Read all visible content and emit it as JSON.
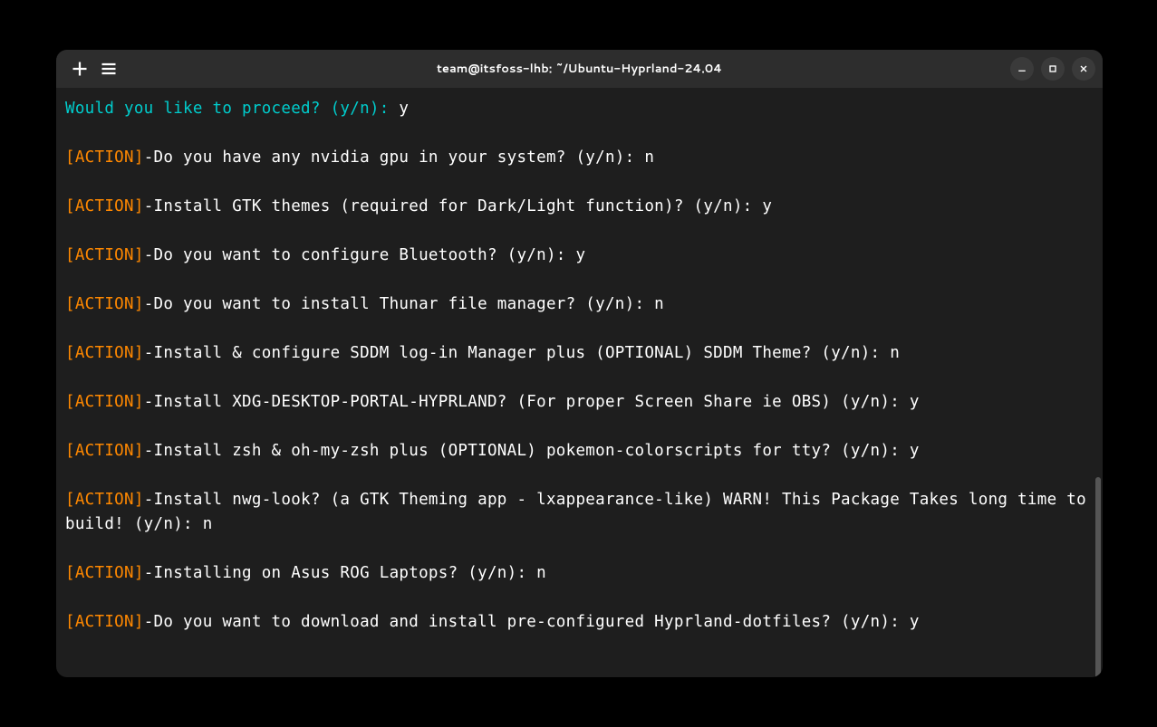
{
  "window": {
    "title": "team@itsfoss-lhb: ~/Ubuntu-Hyprland-24.04"
  },
  "prompt": {
    "question": "Would you like to proceed? (y/n): ",
    "answer": "y"
  },
  "actions": [
    {
      "label": "[ACTION]",
      "text": "-Do you have any nvidia gpu in your system? (y/n): n"
    },
    {
      "label": "[ACTION]",
      "text": "-Install GTK themes (required for Dark/Light function)? (y/n): y"
    },
    {
      "label": "[ACTION]",
      "text": "-Do you want to configure Bluetooth? (y/n): y"
    },
    {
      "label": "[ACTION]",
      "text": "-Do you want to install Thunar file manager? (y/n): n"
    },
    {
      "label": "[ACTION]",
      "text": "-Install & configure SDDM log-in Manager plus (OPTIONAL) SDDM Theme? (y/n): n"
    },
    {
      "label": "[ACTION]",
      "text": "-Install XDG-DESKTOP-PORTAL-HYPRLAND? (For proper Screen Share ie OBS) (y/n): y"
    },
    {
      "label": "[ACTION]",
      "text": "-Install zsh & oh-my-zsh plus (OPTIONAL) pokemon-colorscripts for tty? (y/n): y"
    },
    {
      "label": "[ACTION]",
      "text": "-Install nwg-look? (a GTK Theming app - lxappearance-like) WARN! This Package Takes long time to build! (y/n): n"
    },
    {
      "label": "[ACTION]",
      "text": "-Installing on Asus ROG Laptops? (y/n): n"
    },
    {
      "label": "[ACTION]",
      "text": "-Do you want to download and install pre-configured Hyprland-dotfiles? (y/n): y"
    }
  ]
}
